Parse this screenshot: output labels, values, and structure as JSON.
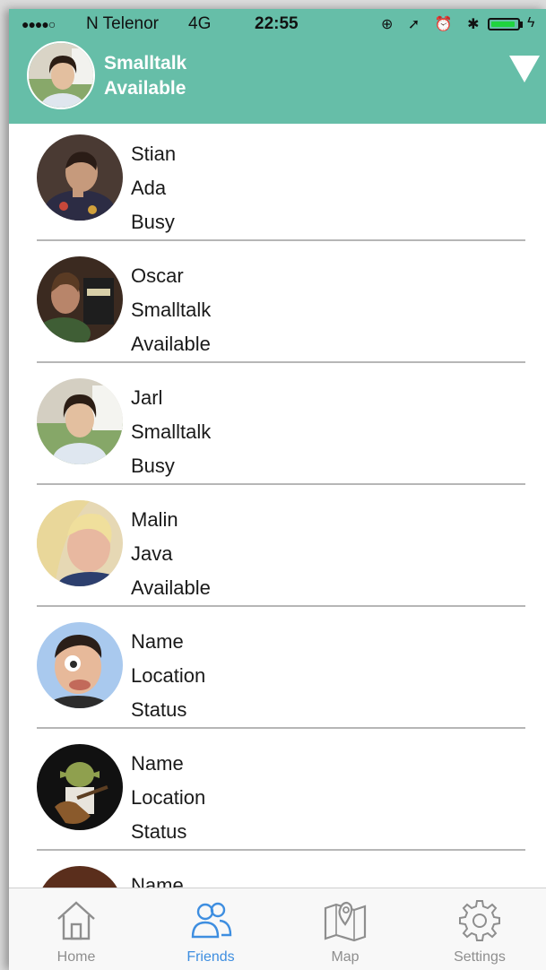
{
  "statusbar": {
    "signal": "●●●●○",
    "carrier": "N Telenor",
    "network": "4G",
    "time": "22:55",
    "icons": "⊕ ➚ ⏰ ✱"
  },
  "header": {
    "name": "Smalltalk",
    "status": "Available",
    "dropdown_icon": "triangle-down-icon"
  },
  "friends": [
    {
      "line1": "Stian",
      "line2": "Ada",
      "line3": "Busy"
    },
    {
      "line1": "Oscar",
      "line2": "Smalltalk",
      "line3": "Available"
    },
    {
      "line1": "Jarl",
      "line2": "Smalltalk",
      "line3": "Busy"
    },
    {
      "line1": "Malin",
      "line2": "Java",
      "line3": "Available"
    },
    {
      "line1": "Name",
      "line2": "Location",
      "line3": "Status"
    },
    {
      "line1": "Name",
      "line2": "Location",
      "line3": "Status"
    },
    {
      "line1": "Name",
      "line2": "",
      "line3": ""
    }
  ],
  "tabs": [
    {
      "label": "Home",
      "icon": "home-icon"
    },
    {
      "label": "Friends",
      "icon": "friends-icon"
    },
    {
      "label": "Map",
      "icon": "map-icon"
    },
    {
      "label": "Settings",
      "icon": "gear-icon"
    }
  ],
  "colors": {
    "header_bg": "#66bea8",
    "active_tab": "#3e8ee0",
    "inactive_tab": "#8e8e8e"
  }
}
